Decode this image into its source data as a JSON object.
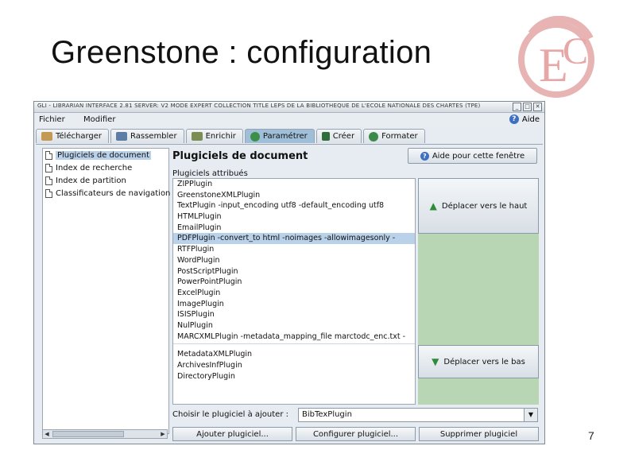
{
  "slide": {
    "title": "Greenstone : configuration",
    "page_number": "7",
    "logo_text": "ÉC"
  },
  "window": {
    "title": "GLI - LIBRARIAN INTERFACE 2.81 SERVER: V2 MODE EXPERT COLLECTION TITLE LEPS DE LA BIBLIOTHEQUE DE L'ECOLE NATIONALE DES CHARTES (TPE)",
    "controls": [
      "_",
      "□",
      "✕"
    ]
  },
  "menubar": {
    "file": "Fichier",
    "edit": "Modifier",
    "help": "Aide"
  },
  "tabs": [
    {
      "label": "Télécharger",
      "color": "#c49a52"
    },
    {
      "label": "Rassembler",
      "color": "#5c7ea6"
    },
    {
      "label": "Enrichir",
      "color": "#7b8f54"
    },
    {
      "label": "Paramétrer",
      "color": "#3d8f47",
      "active": true
    },
    {
      "label": "Créer",
      "color": "#2f6e3a"
    },
    {
      "label": "Formater",
      "color": "#3b8a4a"
    }
  ],
  "sidebar": {
    "items": [
      {
        "label": "Plugiciels de document"
      },
      {
        "label": "Index de recherche"
      },
      {
        "label": "Index de partition"
      },
      {
        "label": "Classificateurs de navigation"
      }
    ]
  },
  "main": {
    "title": "Plugiciels de document",
    "help_button": "Aide pour cette fenêtre",
    "list_label": "Plugiciels attribués",
    "plugins": [
      "ZIPPlugin",
      "GreenstoneXMLPlugin",
      "TextPlugin -input_encoding utf8 -default_encoding utf8",
      "HTMLPlugin",
      "EmailPlugin",
      "PDFPlugin -convert_to html -noimages -allowimagesonly -",
      "RTFPlugin",
      "WordPlugin",
      "PostScriptPlugin",
      "PowerPointPlugin",
      "ExcelPlugin",
      "ImagePlugin",
      "ISISPlugin",
      "NulPlugin",
      "MARCXMLPlugin -metadata_mapping_file marctodc_enc.txt -",
      "MetadataXMLPlugin",
      "ArchivesInfPlugin",
      "DirectoryPlugin"
    ],
    "move_up": "Déplacer vers le haut",
    "move_down": "Déplacer vers le bas",
    "choose_label": "Choisir le plugiciel à ajouter :",
    "choose_value": "BibTexPlugin",
    "add_button": "Ajouter plugiciel...",
    "configure_button": "Configurer plugiciel...",
    "remove_button": "Supprimer plugiciel"
  }
}
